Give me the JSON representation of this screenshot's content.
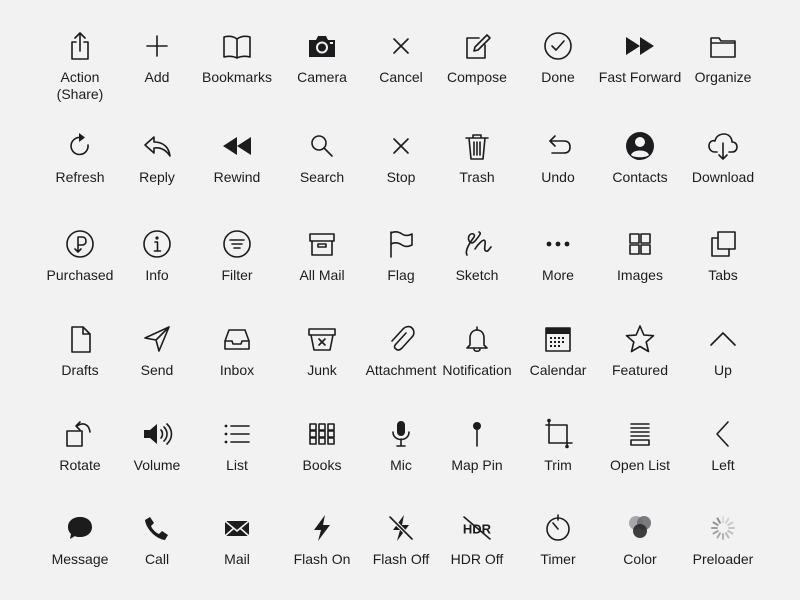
{
  "icons": [
    {
      "name": "action-share-icon",
      "label": "Action\n(Share)"
    },
    {
      "name": "add-icon",
      "label": "Add"
    },
    {
      "name": "bookmarks-icon",
      "label": "Bookmarks"
    },
    {
      "name": "camera-icon",
      "label": "Camera"
    },
    {
      "name": "cancel-icon",
      "label": "Cancel"
    },
    {
      "name": "compose-icon",
      "label": "Compose"
    },
    {
      "name": "done-icon",
      "label": "Done"
    },
    {
      "name": "fast-forward-icon",
      "label": "Fast Forward"
    },
    {
      "name": "organize-icon",
      "label": "Organize"
    },
    {
      "name": "refresh-icon",
      "label": "Refresh"
    },
    {
      "name": "reply-icon",
      "label": "Reply"
    },
    {
      "name": "rewind-icon",
      "label": "Rewind"
    },
    {
      "name": "search-icon",
      "label": "Search"
    },
    {
      "name": "stop-icon",
      "label": "Stop"
    },
    {
      "name": "trash-icon",
      "label": "Trash"
    },
    {
      "name": "undo-icon",
      "label": "Undo"
    },
    {
      "name": "contacts-icon",
      "label": "Contacts"
    },
    {
      "name": "download-icon",
      "label": "Download"
    },
    {
      "name": "purchased-icon",
      "label": "Purchased"
    },
    {
      "name": "info-icon",
      "label": "Info"
    },
    {
      "name": "filter-icon",
      "label": "Filter"
    },
    {
      "name": "all-mail-icon",
      "label": "All Mail"
    },
    {
      "name": "flag-icon",
      "label": "Flag"
    },
    {
      "name": "sketch-icon",
      "label": "Sketch"
    },
    {
      "name": "more-icon",
      "label": "More"
    },
    {
      "name": "images-icon",
      "label": "Images"
    },
    {
      "name": "tabs-icon",
      "label": "Tabs"
    },
    {
      "name": "drafts-icon",
      "label": "Drafts"
    },
    {
      "name": "send-icon",
      "label": "Send"
    },
    {
      "name": "inbox-icon",
      "label": "Inbox"
    },
    {
      "name": "junk-icon",
      "label": "Junk"
    },
    {
      "name": "attachment-icon",
      "label": "Attachment"
    },
    {
      "name": "notification-icon",
      "label": "Notification"
    },
    {
      "name": "calendar-icon",
      "label": "Calendar"
    },
    {
      "name": "featured-icon",
      "label": "Featured"
    },
    {
      "name": "up-icon",
      "label": "Up"
    },
    {
      "name": "rotate-icon",
      "label": "Rotate"
    },
    {
      "name": "volume-icon",
      "label": "Volume"
    },
    {
      "name": "list-icon",
      "label": "List"
    },
    {
      "name": "books-icon",
      "label": "Books"
    },
    {
      "name": "mic-icon",
      "label": "Mic"
    },
    {
      "name": "map-pin-icon",
      "label": "Map Pin"
    },
    {
      "name": "trim-icon",
      "label": "Trim"
    },
    {
      "name": "open-list-icon",
      "label": "Open List"
    },
    {
      "name": "left-icon",
      "label": "Left"
    },
    {
      "name": "message-icon",
      "label": "Message"
    },
    {
      "name": "call-icon",
      "label": "Call"
    },
    {
      "name": "mail-icon",
      "label": "Mail"
    },
    {
      "name": "flash-on-icon",
      "label": "Flash On"
    },
    {
      "name": "flash-off-icon",
      "label": "Flash Off"
    },
    {
      "name": "hdr-off-icon",
      "label": "HDR Off",
      "glyph_text": "HDR"
    },
    {
      "name": "timer-icon",
      "label": "Timer"
    },
    {
      "name": "color-icon",
      "label": "Color"
    },
    {
      "name": "preloader-icon",
      "label": "Preloader"
    }
  ],
  "colors": {
    "background": "#f2f2f3",
    "ink": "#1c1c1e",
    "color_dots": [
      "#2b2b2d",
      "#6d6d72",
      "#a7a7ad"
    ],
    "preloader_spokes": "#8e8e93"
  }
}
